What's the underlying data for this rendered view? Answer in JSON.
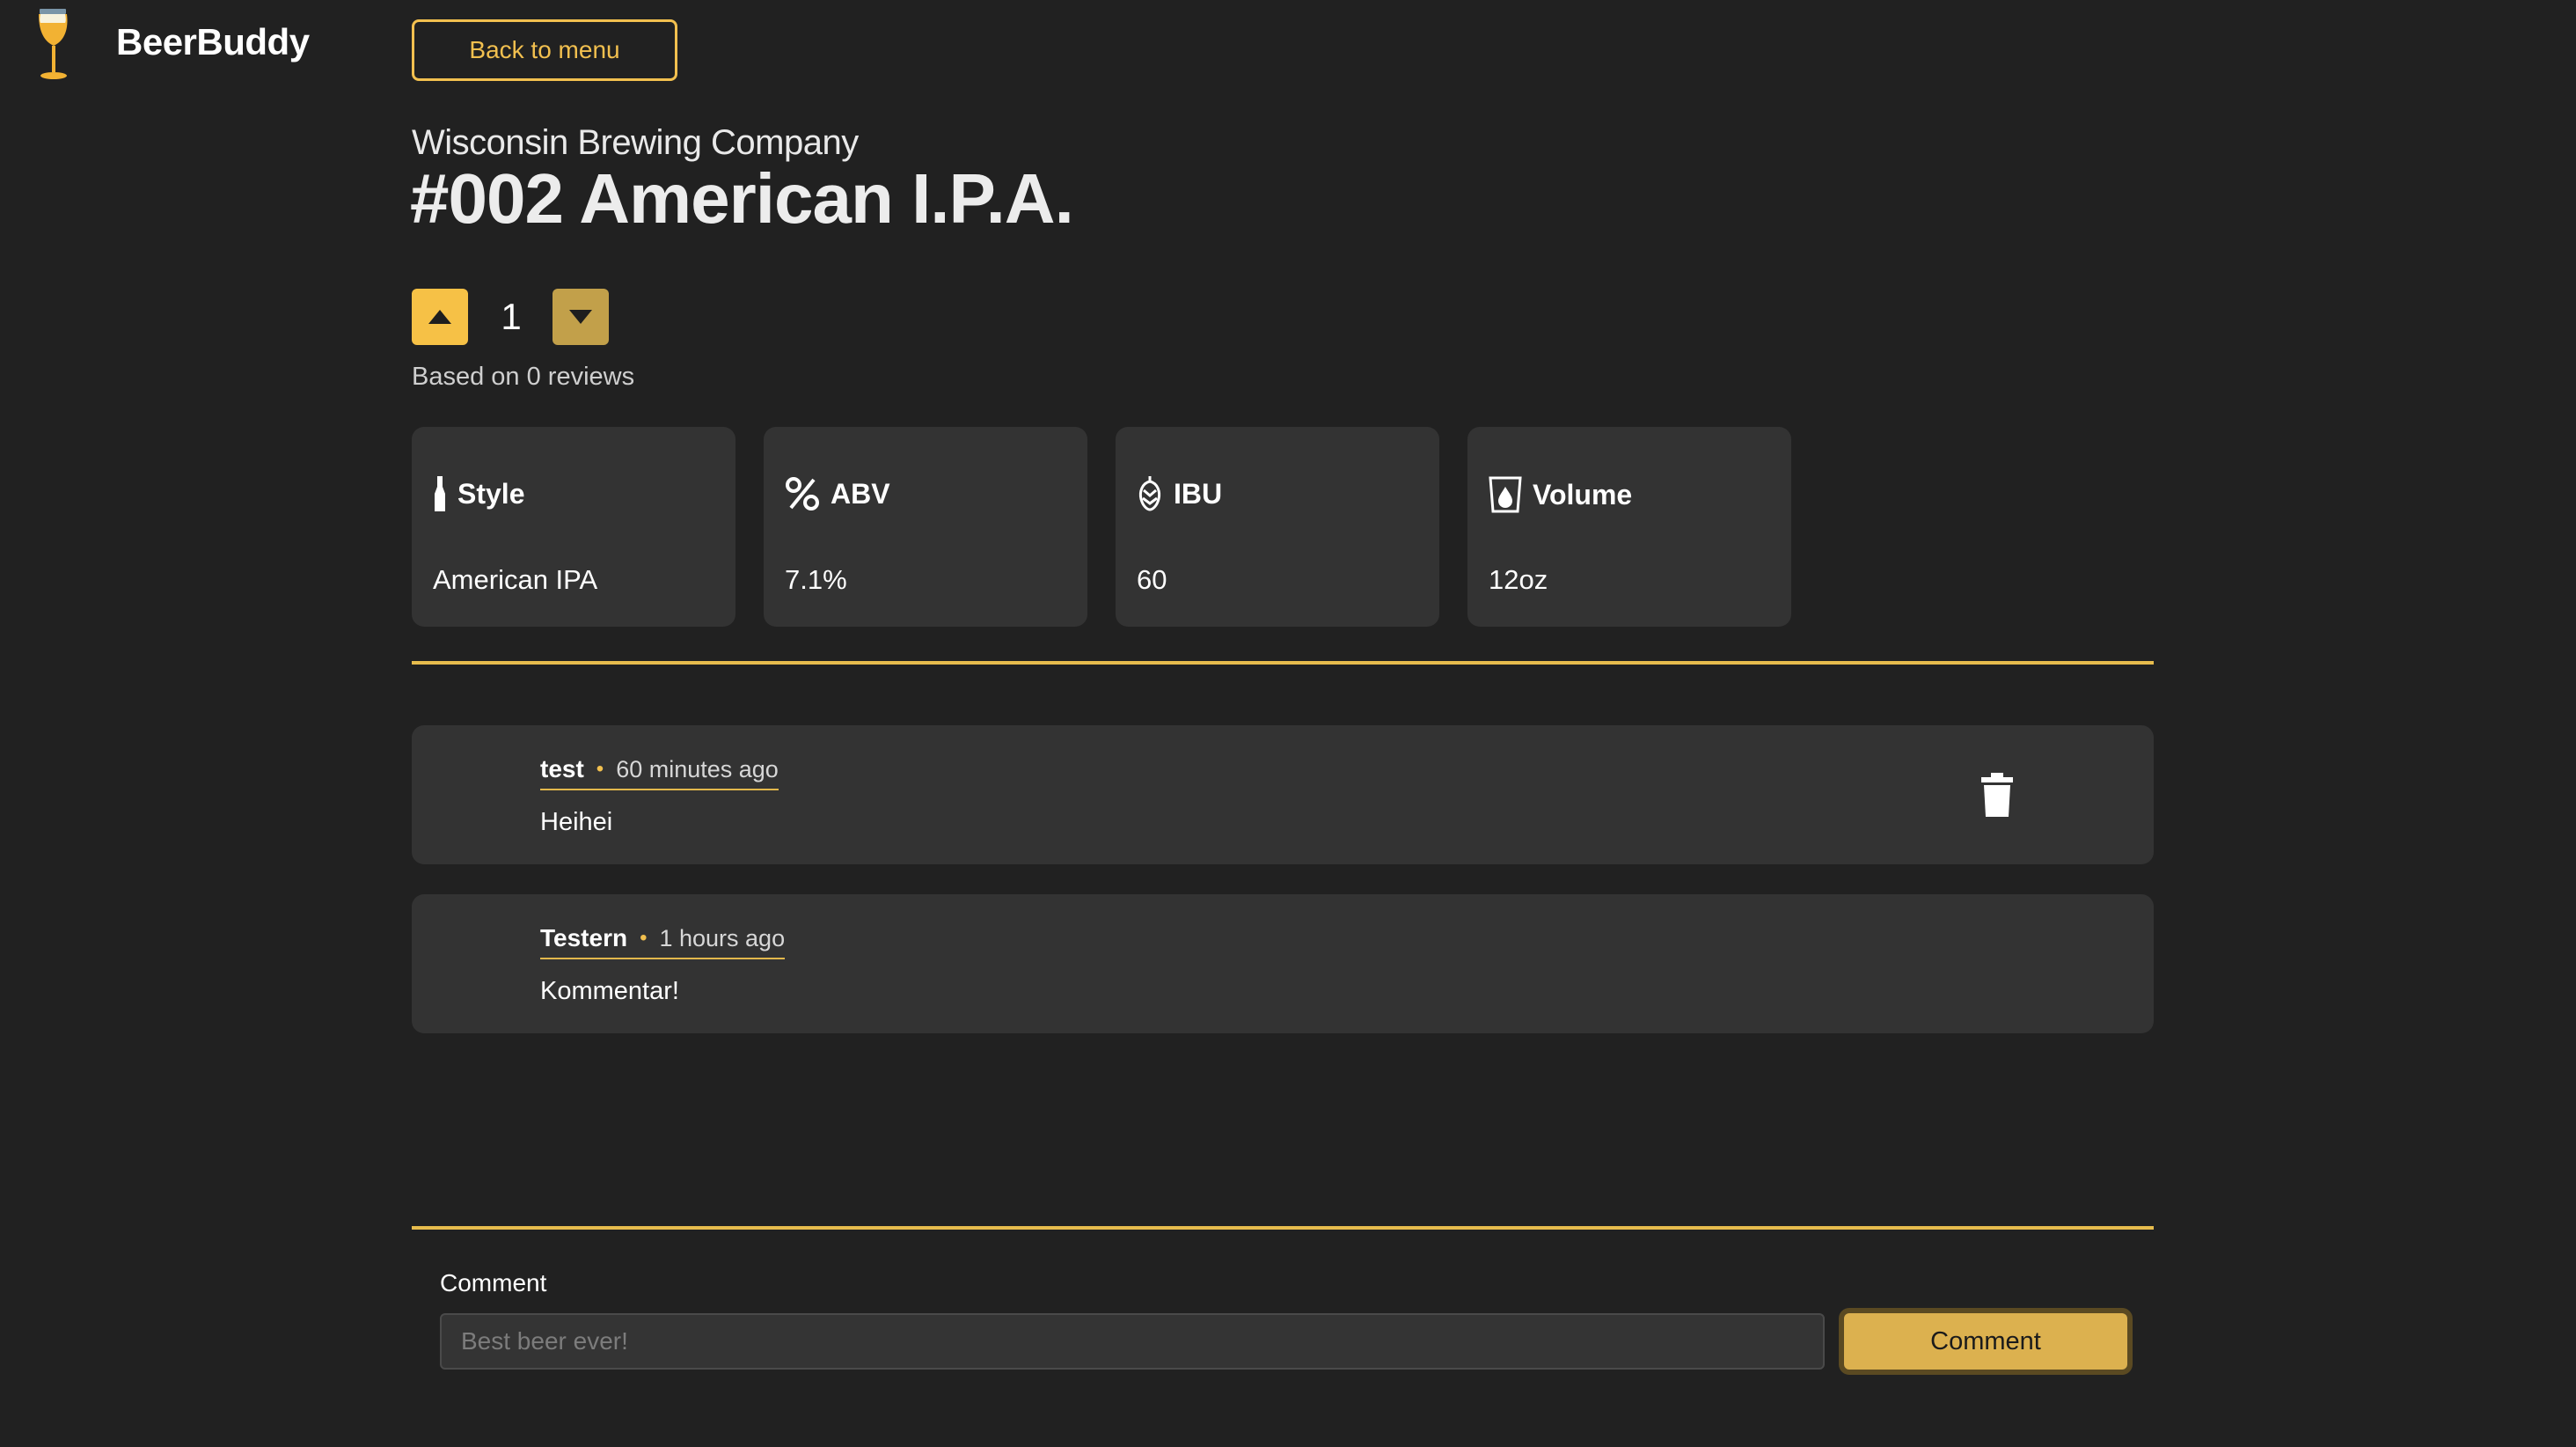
{
  "app": {
    "brand": "BeerBuddy",
    "logo_icon": "beer-glass-icon",
    "back_label": "Back to menu"
  },
  "beer": {
    "brewery": "Wisconsin Brewing Company",
    "title": "#002 American I.P.A.",
    "votes": "1",
    "review_basis": "Based on 0 reviews"
  },
  "stats": [
    {
      "icon": "bottle-icon",
      "label": "Style",
      "value": "American IPA"
    },
    {
      "icon": "percent-icon",
      "label": "ABV",
      "value": "7.1%"
    },
    {
      "icon": "hop-icon",
      "label": "IBU",
      "value": "60"
    },
    {
      "icon": "volume-drop-icon",
      "label": "Volume",
      "value": "12oz"
    }
  ],
  "comments": [
    {
      "author": "test",
      "time": "60 minutes ago",
      "text": "Heihei",
      "deletable": true
    },
    {
      "author": "Testern",
      "time": "1 hours ago",
      "text": "Kommentar!",
      "deletable": false
    }
  ],
  "form": {
    "label": "Comment",
    "placeholder": "Best beer ever!",
    "value": "",
    "submit_label": "Comment"
  },
  "colors": {
    "background": "#212121",
    "card": "#333333",
    "accent": "#f2c04f",
    "vote_up": "#f6c146",
    "vote_down": "#c2a04a",
    "submit": "#dcb14f"
  }
}
